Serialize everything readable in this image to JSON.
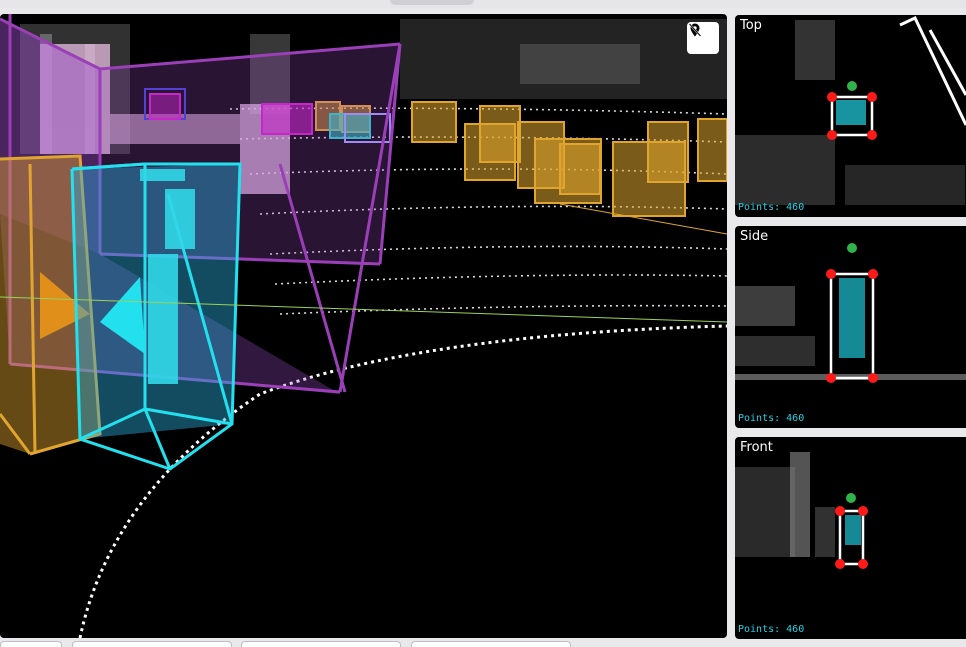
{
  "main_view": {
    "pin_icon": "location-off-icon"
  },
  "panels": {
    "top": {
      "title": "Top",
      "points_label": "Points: 460"
    },
    "side": {
      "title": "Side",
      "points_label": "Points: 460"
    },
    "front": {
      "title": "Front",
      "points_label": "Points: 460"
    }
  },
  "colors": {
    "selected_box": "#22e0ee",
    "vehicle_box": "#e0a52e",
    "large_box": "#9b3fb8",
    "pedestrian_box": "#d419c8",
    "handle": "#ff1a1a",
    "direction_handle": "#2fb34a"
  }
}
